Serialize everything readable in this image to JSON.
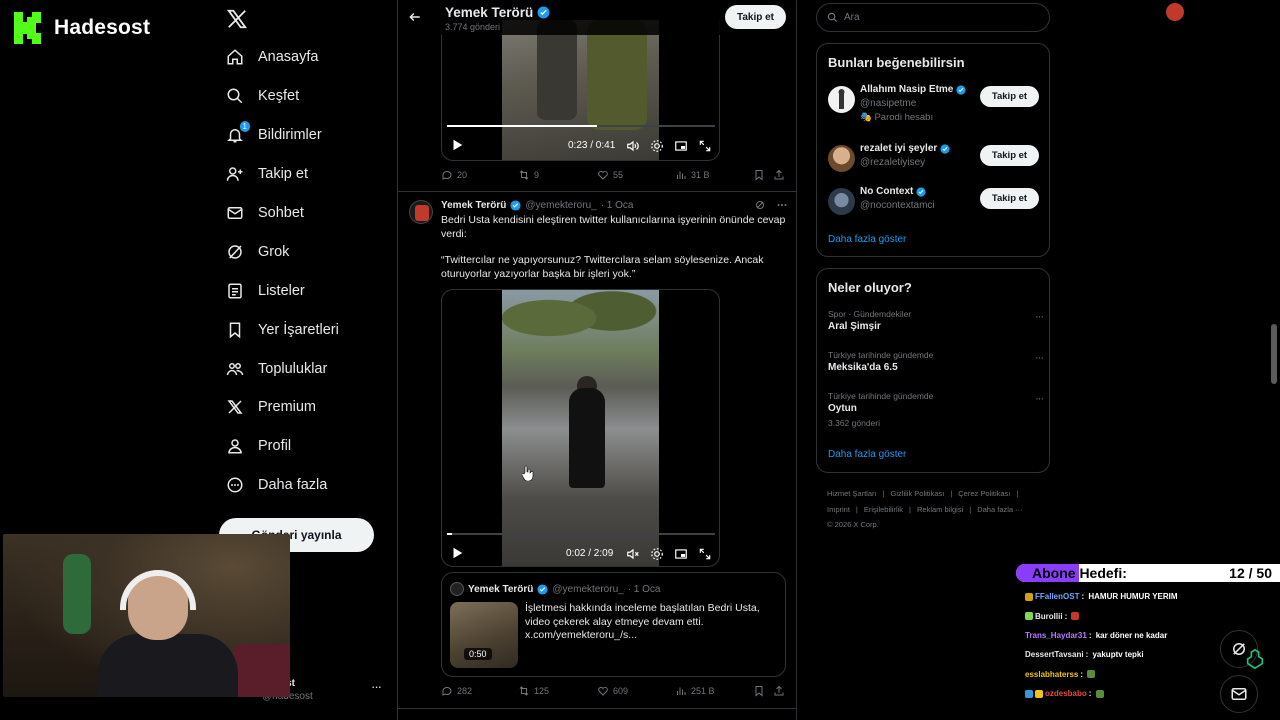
{
  "brand": {
    "name": "Hadesost"
  },
  "nav": {
    "items": [
      {
        "label": "Anasayfa",
        "icon": "home-icon"
      },
      {
        "label": "Keşfet",
        "icon": "search-icon"
      },
      {
        "label": "Bildirimler",
        "icon": "bell-icon",
        "badge": "1"
      },
      {
        "label": "Takip et",
        "icon": "follow-icon"
      },
      {
        "label": "Sohbet",
        "icon": "mail-icon"
      },
      {
        "label": "Grok",
        "icon": "grok-icon"
      },
      {
        "label": "Listeler",
        "icon": "list-icon"
      },
      {
        "label": "Yer İşaretleri",
        "icon": "bookmark-icon"
      },
      {
        "label": "Topluluklar",
        "icon": "communities-icon"
      },
      {
        "label": "Premium",
        "icon": "x-icon"
      },
      {
        "label": "Profil",
        "icon": "profile-icon"
      },
      {
        "label": "Daha fazla",
        "icon": "more-icon"
      }
    ],
    "post_button": "Gönderi yayınla"
  },
  "account": {
    "name": "ost",
    "handle": "@hadesost",
    "more": "···"
  },
  "feed": {
    "header": {
      "title": "Yemek Terörü",
      "count": "3.774 gönderi",
      "follow": "Takip et"
    },
    "tweet1": {
      "video_time": "0:23 / 0:41",
      "progress": 0.56,
      "replies": "20",
      "retweets": "9",
      "likes": "55",
      "views": "31 B"
    },
    "tweet2": {
      "name": "Yemek Terörü",
      "handle": "@yemekteroru_",
      "date": "· 1 Oca",
      "text1": "Bedri Usta kendisini eleştiren twitter kullanıcılarına işyerinin önünde cevap verdi:",
      "text2": "“Twittercılar ne yapıyorsunuz? Twittercılara selam söylesenize. Ancak oturuyorlar yazıyorlar başka bir işleri yok.”",
      "video_time": "0:02 / 2:09",
      "progress": 0.02,
      "quote": {
        "name": "Yemek Terörü",
        "handle": "@yemekteroru_",
        "date": "· 1 Oca",
        "text": "İşletmesi hakkında inceleme başlatılan Bedri Usta, video çekerek alay etmeye devam etti. x.com/yemekteroru_/s...",
        "duration": "0:50"
      },
      "replies": "282",
      "retweets": "125",
      "likes": "609",
      "views": "251 B"
    }
  },
  "search": {
    "placeholder": "Ara"
  },
  "suggestions": {
    "title": "Bunları beğenebilirsin",
    "users": [
      {
        "name": "Allahım Nasip Etme",
        "handle": "@nasipetme",
        "note": "Parodi hesabı",
        "follow": "Takip et"
      },
      {
        "name": "rezalet iyi şeyler",
        "handle": "@rezaletiyisey",
        "note": "",
        "follow": "Takip et"
      },
      {
        "name": "No Context",
        "handle": "@nocontextamci",
        "note": "",
        "follow": "Takip et"
      }
    ],
    "more": "Daha fazla göster"
  },
  "trends": {
    "title": "Neler oluyor?",
    "items": [
      {
        "category": "Spor · Gündemdekiler",
        "topic": "Aral Şimşir",
        "count": ""
      },
      {
        "category": "Türkiye tarihinde gündemde",
        "topic": "Meksika'da 6.5",
        "count": ""
      },
      {
        "category": "Türkiye tarihinde gündemde",
        "topic": "Oytun",
        "count": "3.362 gönderi"
      }
    ],
    "more": "Daha fazla göster"
  },
  "footer": {
    "line1": [
      "Hizmet Şartları",
      "|",
      "Gizlilik Politikası",
      "|",
      "Çerez Politikası",
      "|"
    ],
    "line2": [
      "Imprint",
      "|",
      "Erişilebilirlik",
      "|",
      "Reklam bilgisi",
      "|",
      "Daha fazla ···"
    ],
    "copyright": "© 2026 X Corp."
  },
  "overlay": {
    "sub_goal_label": "Abone Hedefi:",
    "sub_goal_value": "12 / 50",
    "sub_goal_progress": 0.24,
    "chat": [
      {
        "user": "FFallenOST",
        "msg": "HAMUR HUMUR YERIM"
      },
      {
        "user": "Burollii",
        "msg": ""
      },
      {
        "user": "Trans_Haydar31",
        "msg": "kar döner ne kadar"
      },
      {
        "user": "DessertTavsani",
        "msg": "yakuptv tepki"
      },
      {
        "user": "esslabhaterss",
        "msg": ""
      },
      {
        "user": "ozdesbabo",
        "msg": ""
      }
    ]
  },
  "colors": {
    "accent": "#1d9bf0",
    "background": "#000000",
    "border": "#2f3336",
    "sub_bar": "#8b3dff"
  }
}
